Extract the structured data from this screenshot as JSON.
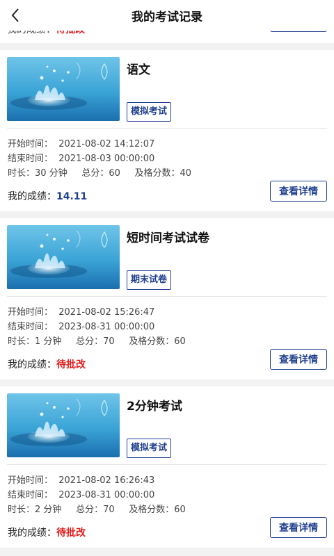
{
  "header": {
    "title": "我的考试记录"
  },
  "partial": {
    "score_label": "我的成绩：",
    "score_value": "待批改"
  },
  "colors": {
    "accent": "#1f3f8f",
    "pending": "#e31b1b",
    "score_blue": "#1f3f8f"
  },
  "cards": [
    {
      "name": "语文",
      "tag": "模拟考试",
      "start": "开始时间：  2021-08-02 14:12:07",
      "end": "结束时间：  2021-08-03 00:00:00",
      "meta": "时长：30 分钟     总分：60     及格分数：40",
      "score_label": "我的成绩：",
      "score_value": "14.11",
      "score_color": "#1f3f8f",
      "detail_label": "查看详情"
    },
    {
      "name": "短时间考试试卷",
      "tag": "期末试卷",
      "start": "开始时间：  2021-08-02 15:26:47",
      "end": "结束时间：  2023-08-31 00:00:00",
      "meta": "时长：1 分钟     总分：70     及格分数：60",
      "score_label": "我的成绩：",
      "score_value": "待批改",
      "score_color": "#e31b1b",
      "detail_label": "查看详情"
    },
    {
      "name": "2分钟考试",
      "tag": "模拟考试",
      "start": "开始时间：  2021-08-02 16:26:43",
      "end": "结束时间：  2023-08-31 00:00:00",
      "meta": "时长：2 分钟     总分：70     及格分数：60",
      "score_label": "我的成绩：",
      "score_value": "待批改",
      "score_color": "#e31b1b",
      "detail_label": "查看详情"
    }
  ]
}
